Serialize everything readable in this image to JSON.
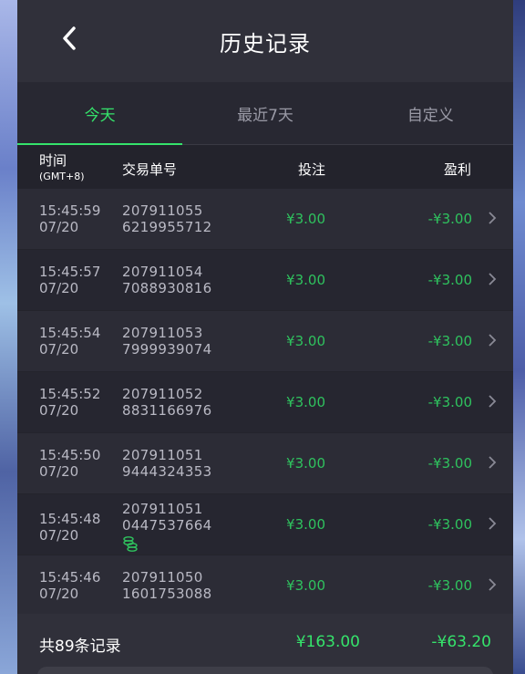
{
  "header": {
    "title": "历史记录",
    "back_icon": "chevron-left-icon"
  },
  "tabs": [
    {
      "label": "今天",
      "active": true
    },
    {
      "label": "最近7天",
      "active": false
    },
    {
      "label": "自定义",
      "active": false
    }
  ],
  "columns": {
    "time": "时间",
    "timezone": "(GMT+8)",
    "order": "交易单号",
    "bet": "投注",
    "profit": "盈利"
  },
  "records": [
    {
      "time": "15:45:59",
      "date": "07/20",
      "order_a": "207911055",
      "order_b": "6219955712",
      "bet": "¥3.00",
      "profit": "-¥3.00",
      "badge": false
    },
    {
      "time": "15:45:57",
      "date": "07/20",
      "order_a": "207911054",
      "order_b": "7088930816",
      "bet": "¥3.00",
      "profit": "-¥3.00",
      "badge": false
    },
    {
      "time": "15:45:54",
      "date": "07/20",
      "order_a": "207911053",
      "order_b": "7999939074",
      "bet": "¥3.00",
      "profit": "-¥3.00",
      "badge": false
    },
    {
      "time": "15:45:52",
      "date": "07/20",
      "order_a": "207911052",
      "order_b": "8831166976",
      "bet": "¥3.00",
      "profit": "-¥3.00",
      "badge": false
    },
    {
      "time": "15:45:50",
      "date": "07/20",
      "order_a": "207911051",
      "order_b": "9444324353",
      "bet": "¥3.00",
      "profit": "-¥3.00",
      "badge": false
    },
    {
      "time": "15:45:48",
      "date": "07/20",
      "order_a": "207911051",
      "order_b": "0447537664",
      "bet": "¥3.00",
      "profit": "-¥3.00",
      "badge": true
    },
    {
      "time": "15:45:46",
      "date": "07/20",
      "order_a": "207911050",
      "order_b": "1601753088",
      "bet": "¥3.00",
      "profit": "-¥3.00",
      "badge": false
    }
  ],
  "footer": {
    "count": "共89条记录",
    "total_bet": "¥163.00",
    "total_profit": "-¥63.20"
  },
  "colors": {
    "accent_green": "#35e36b",
    "value_green": "#2fc25e",
    "panel_bg": "#26262f"
  }
}
